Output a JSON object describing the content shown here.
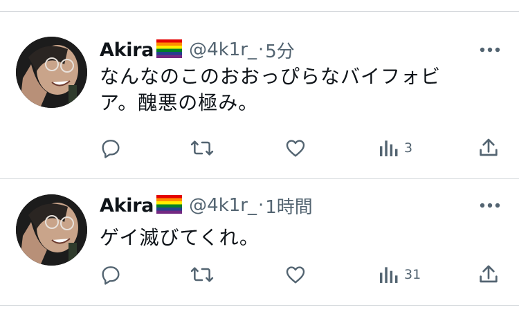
{
  "tweets": [
    {
      "name": "Akira",
      "flag_icon": "rainbow-flag-icon",
      "handle": "@4k1r_",
      "separator": "·",
      "time": "5分",
      "text_line1": "なんなのこのおおっぴらなバイフォビ",
      "text_line2": "ア。醜悪の極み。",
      "views": "3"
    },
    {
      "name": "Akira",
      "flag_icon": "rainbow-flag-icon",
      "handle": "@4k1r_",
      "separator": "·",
      "time": "1時間",
      "text_line1": "ゲイ滅びてくれ。",
      "text_line2": "",
      "views": "31"
    }
  ],
  "colors": {
    "text": "#0f1419",
    "secondary": "#536471",
    "divider": "#d4d8dc"
  }
}
